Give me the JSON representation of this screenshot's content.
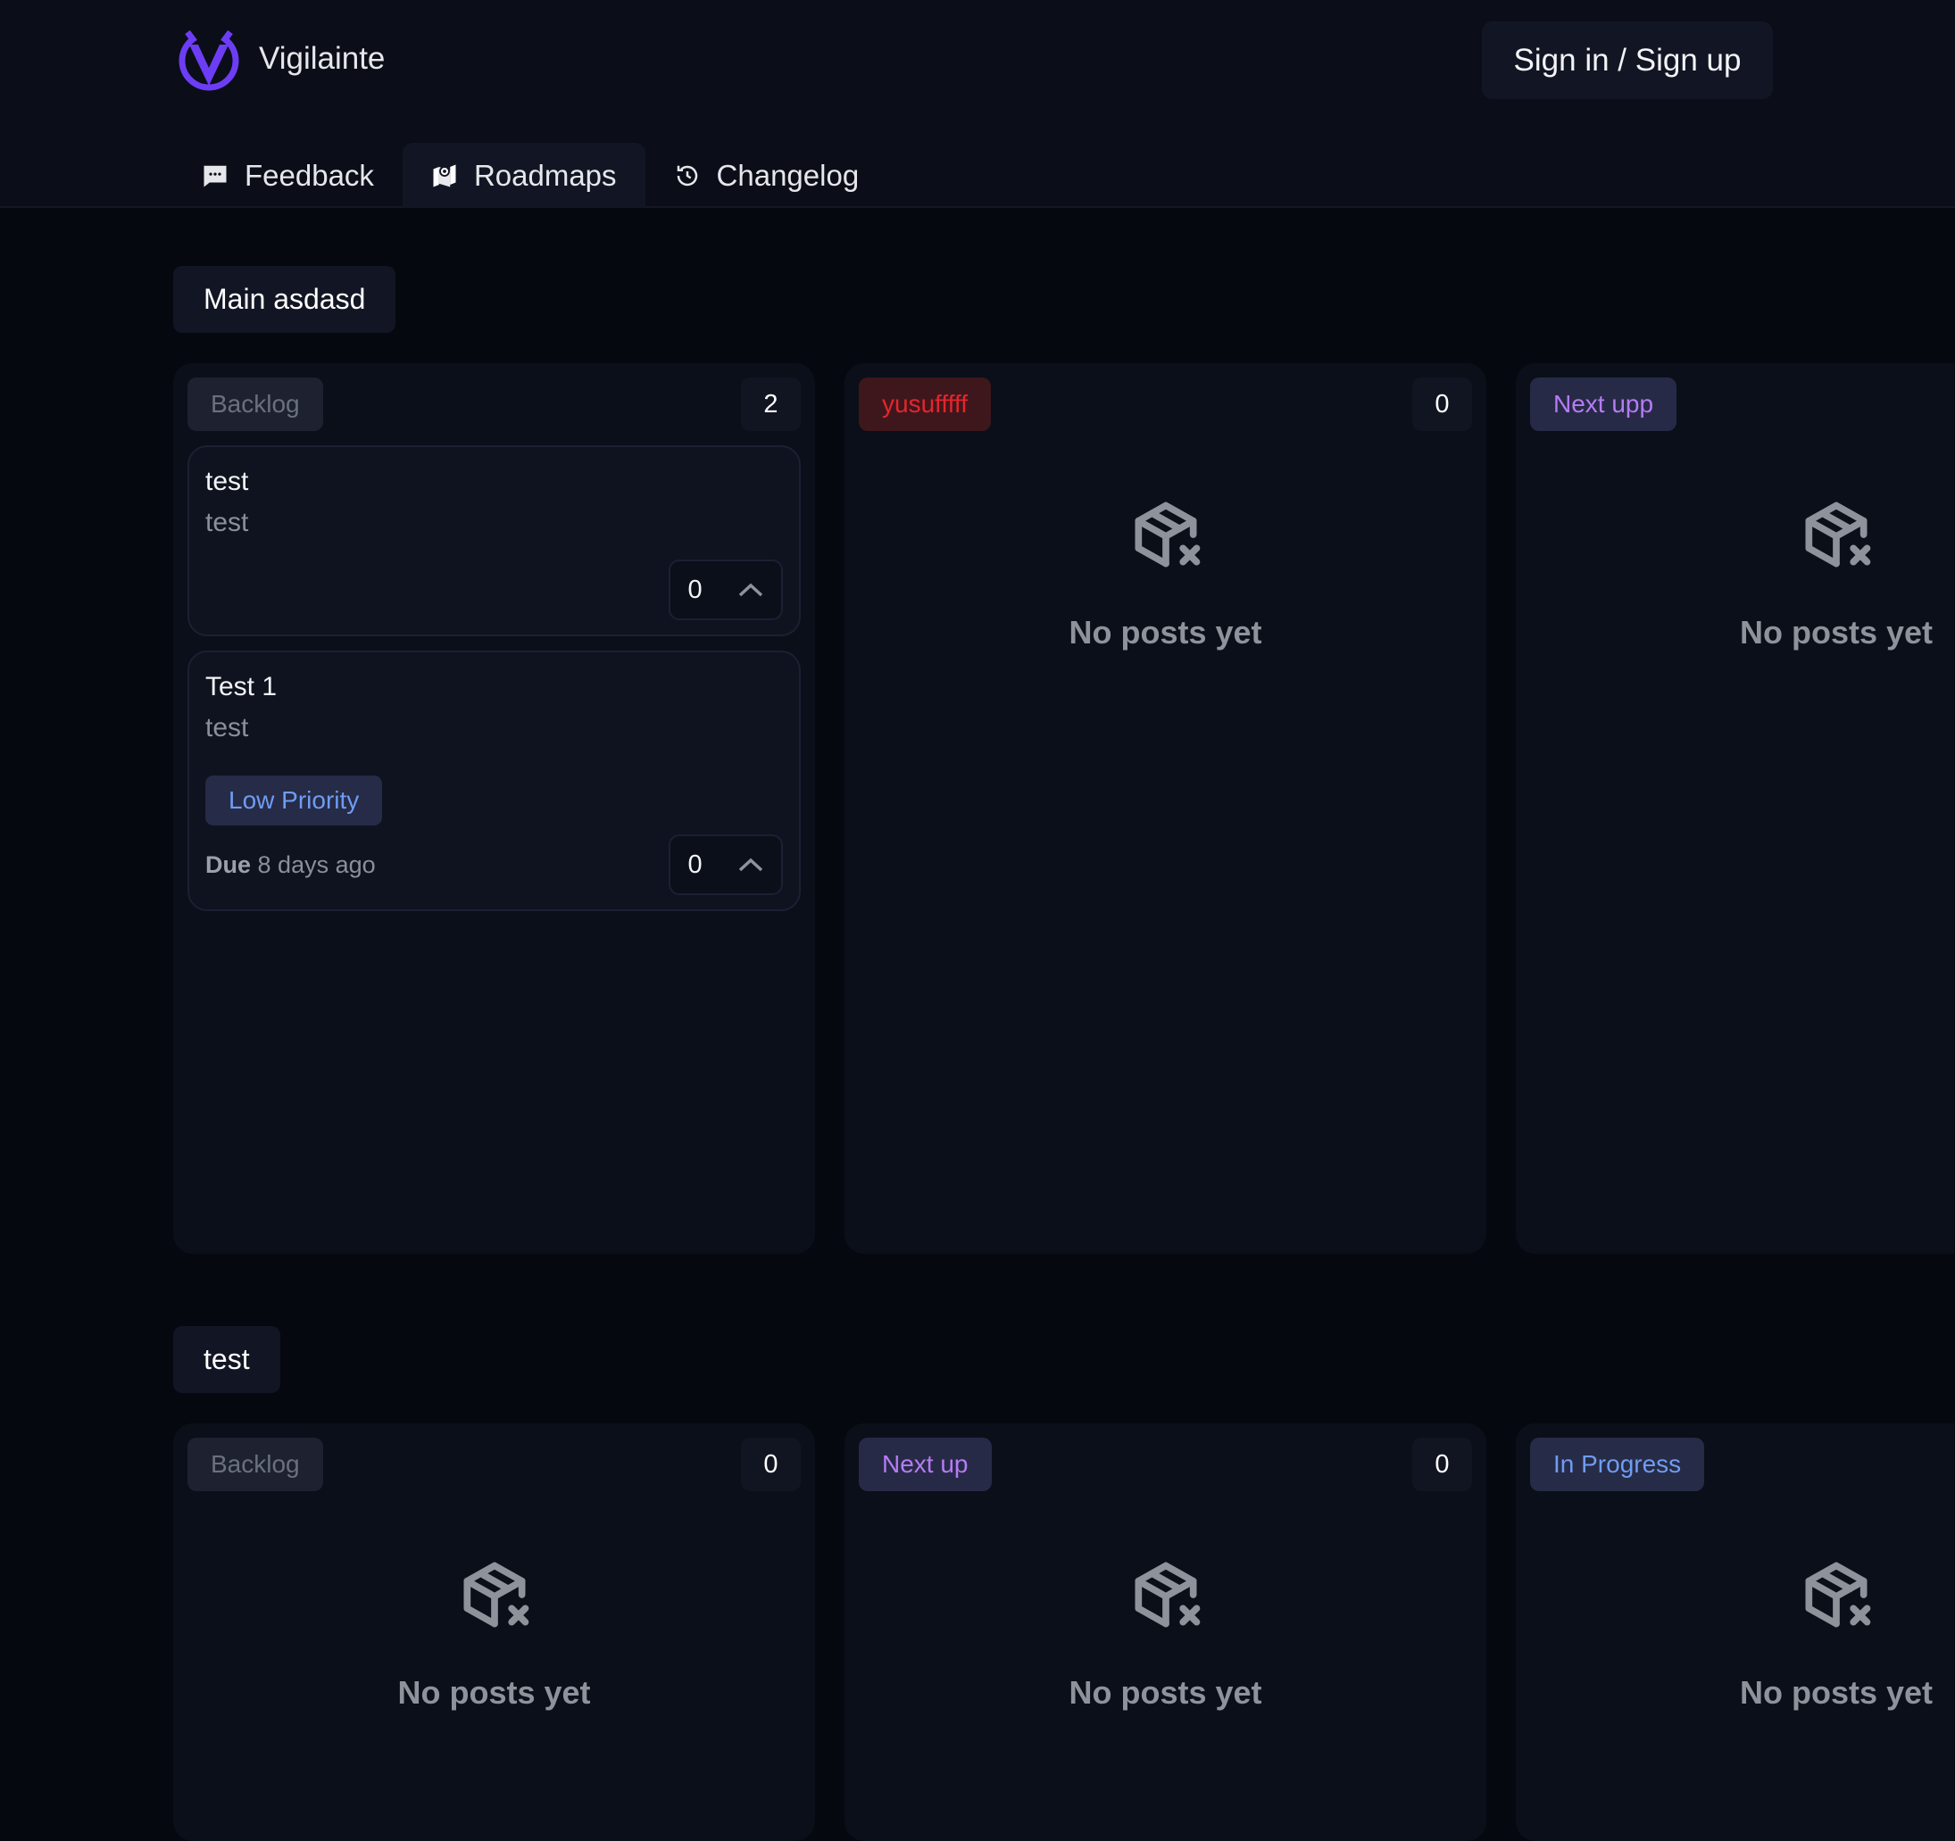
{
  "header": {
    "brand": "Vigilainte",
    "signin_label": "Sign in / Sign up",
    "logo_color": "#6d3df5"
  },
  "nav": {
    "tabs": [
      {
        "label": "Feedback",
        "icon": "chat-icon",
        "active": false
      },
      {
        "label": "Roadmaps",
        "icon": "map-icon",
        "active": true
      },
      {
        "label": "Changelog",
        "icon": "history-icon",
        "active": false
      }
    ]
  },
  "empty_text": "No posts yet",
  "due_label": "Due",
  "sections": [
    {
      "title": "Main asdasd",
      "columns": [
        {
          "status": "Backlog",
          "bg": "#1d2130",
          "fg": "#6b7080",
          "count": "2",
          "posts": [
            {
              "title": "test",
              "desc": "test",
              "votes": "0"
            },
            {
              "title": "Test 1",
              "desc": "test",
              "tag": "Low Priority",
              "due": "8 days ago",
              "votes": "0"
            }
          ]
        },
        {
          "status": "yusufffff",
          "bg": "#3e171d",
          "fg": "#e5252b",
          "count": "0",
          "posts": []
        },
        {
          "status": "Next upp",
          "bg": "#272a47",
          "fg": "#b57cf3",
          "posts": []
        }
      ]
    },
    {
      "title": "test",
      "columns": [
        {
          "status": "Backlog",
          "bg": "#1d2130",
          "fg": "#6b7080",
          "count": "0",
          "posts": []
        },
        {
          "status": "Next up",
          "bg": "#272a47",
          "fg": "#b57cf3",
          "count": "0",
          "posts": []
        },
        {
          "status": "In Progress",
          "bg": "#262b47",
          "fg": "#6f9cf2",
          "posts": []
        }
      ]
    }
  ]
}
